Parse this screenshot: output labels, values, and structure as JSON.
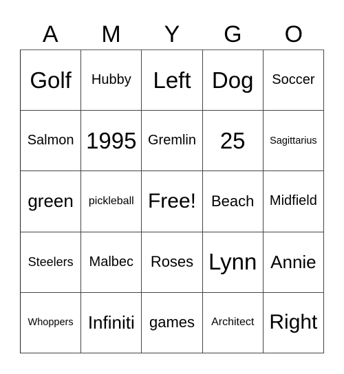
{
  "header": {
    "letters": [
      "A",
      "M",
      "Y",
      "G",
      "O"
    ]
  },
  "board": {
    "rows": [
      [
        "Golf",
        "Hubby",
        "Left",
        "Dog",
        "Soccer"
      ],
      [
        "Salmon",
        "1995",
        "Gremlin",
        "25",
        "Sagittarius"
      ],
      [
        "green",
        "pickleball",
        "Free!",
        "Beach",
        "Midfield"
      ],
      [
        "Steelers",
        "Malbec",
        "Roses",
        "Lynn",
        "Annie"
      ],
      [
        "Whoppers",
        "Infiniti",
        "games",
        "Architect",
        "Right"
      ]
    ],
    "free_space": "Free!"
  }
}
